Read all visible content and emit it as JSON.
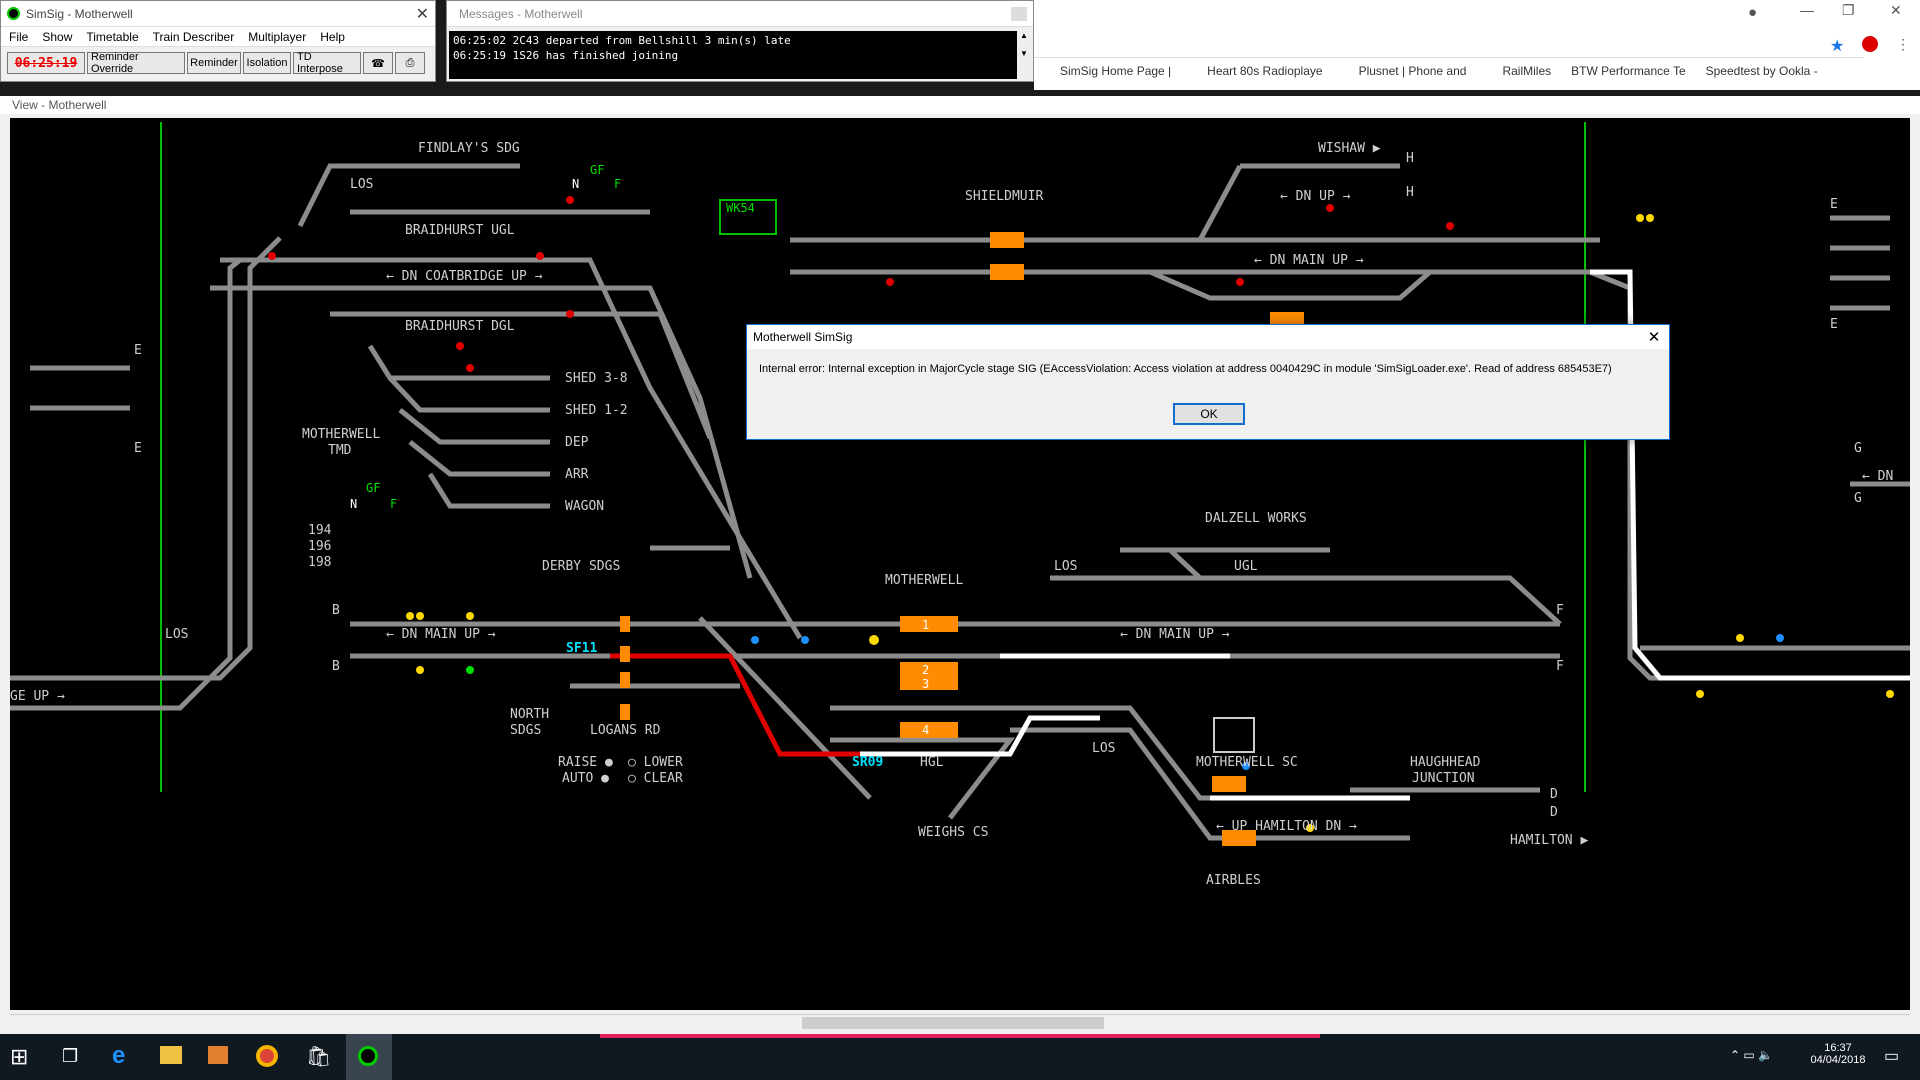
{
  "main_window": {
    "title": "SimSig - Motherwell",
    "menu": [
      "File",
      "Show",
      "Timetable",
      "Train Describer",
      "Multiplayer",
      "Help"
    ],
    "clock": "06:25:19",
    "buttons": [
      "Reminder Override",
      "Reminder",
      "Isolation",
      "TD Interpose"
    ]
  },
  "messages": {
    "title": "Messages - Motherwell",
    "lines": [
      "06:25:02 2C43 departed from Bellshill 3 min(s) late",
      "06:25:19 1S26 has finished joining"
    ]
  },
  "bookmarks": [
    "SimSig Home Page |",
    "Heart 80s Radioplaye",
    "Plusnet | Phone and",
    "RailMiles",
    "BTW Performance Te",
    "Speedtest by Ookla -"
  ],
  "view_title": "View - Motherwell",
  "dialog": {
    "title": "Motherwell SimSig",
    "message": "Internal error: Internal exception in MajorCycle stage SIG (EAccessViolation: Access violation at address 0040429C in module 'SimSigLoader.exe'. Read of address 685453E7)",
    "ok": "OK"
  },
  "panel": {
    "labels": {
      "findlays": "FINDLAY'S SDG",
      "los1": "LOS",
      "braidhurst_ugl": "BRAIDHURST UGL",
      "dn_coatbridge": "← DN COATBRIDGE UP →",
      "braidhurst_dgl": "BRAIDHURST DGL",
      "shed38": "SHED 3-8",
      "shed12": "SHED 1-2",
      "dep": "DEP",
      "arr": "ARR",
      "wagon": "WAGON",
      "motherwell_tmd_1": "MOTHERWELL",
      "motherwell_tmd_2": "TMD",
      "gf1": "GF",
      "gf2": "GF",
      "n1": "N",
      "f1": "F",
      "n2": "N",
      "f2": "F",
      "derby": "DERBY SDGS",
      "motherwell": "MOTHERWELL",
      "los2": "LOS",
      "los3": "LOS",
      "los4": "LOS",
      "dn_main_up_1": "← DN MAIN UP →",
      "dn_main_up_2": "← DN MAIN UP →",
      "dn_main_up_3": "← DN MAIN UP →",
      "ge_up": "GE UP →",
      "north_sdgs_1": "NORTH",
      "north_sdgs_2": "SDGS",
      "logans": "LOGANS RD",
      "raise": "RAISE ●",
      "auto": "AUTO ●",
      "lower": "○ LOWER",
      "clear": "○ CLEAR",
      "hgl": "HGL",
      "weighs": "WEIGHS CS",
      "shieldmuir": "SHIELDMUIR",
      "wishaw": "WISHAW ▶",
      "dn_up": "← DN UP →",
      "dalzell": "DALZELL WORKS",
      "ugl": "UGL",
      "motherwell_sc": "MOTHERWELL SC",
      "haughhead_1": "HAUGHHEAD",
      "haughhead_2": "JUNCTION",
      "up_hamilton": "← UP HAMILTON DN →",
      "hamilton": "HAMILTON ▶",
      "airbles": "AIRBLES",
      "wk54": "WK54",
      "sf11": "SF11",
      "sr09": "SR09",
      "b1": "B",
      "b2": "B",
      "f3": "F",
      "f4": "F",
      "e1": "E",
      "e2": "E",
      "e3": "E",
      "e4": "E",
      "h1": "H",
      "h2": "H",
      "d1": "D",
      "d2": "D",
      "g1": "G",
      "g2": "G",
      "dn_r": "← DN",
      "n194": "194",
      "n196": "196",
      "n198": "198",
      "berth1": "1",
      "berth2": "2",
      "berth3": "3",
      "berth4": "4"
    }
  },
  "taskbar": {
    "time": "16:37",
    "date": "04/04/2018"
  },
  "colors": {
    "track": "#8c8c8c",
    "route_red": "#e00000",
    "route_white": "#ffffff",
    "berth": "#ff8c00",
    "signal_red": "#e00000",
    "signal_blue": "#1e90ff",
    "signal_yellow": "#ffd800",
    "cyan": "#00e0ff",
    "green": "#00c000"
  }
}
